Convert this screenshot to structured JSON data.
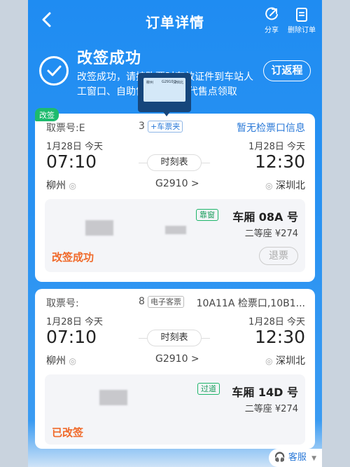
{
  "nav": {
    "title": "订单详情",
    "share_label": "分享",
    "delete_label": "删除订单"
  },
  "status": {
    "title": "改签成功",
    "desc": "改签成功，请持购票时有效证件到车站人工窗口、自助售/取票机或代售点领取",
    "return_btn": "订返程"
  },
  "ticket1": {
    "tag": "改签",
    "pickup_label": "取票号:E",
    "pickup_tail": "3",
    "wallet_badge": "+车票夹",
    "check_info": "暂无检票口信息",
    "depart_date": "1月28日 今天",
    "arrive_date": "1月28日 今天",
    "depart_time": "07:10",
    "arrive_time": "12:30",
    "from": "柳州",
    "to": "深圳北",
    "schedule": "时刻表",
    "train": "G2910 >",
    "seat_tag": "靠窗",
    "seat_num": "车厢 08A 号",
    "seat_class": "二等座 ¥274",
    "seat_status": "改签成功",
    "refund": "退票"
  },
  "ticket2": {
    "pickup_label": "取票号:",
    "pickup_tail": "8",
    "e_ticket_badge": "电子客票",
    "check_info": "10A11A 检票口,10B1...",
    "depart_date": "1月28日 今天",
    "arrive_date": "1月28日 今天",
    "depart_time": "07:10",
    "arrive_time": "12:30",
    "from": "柳州",
    "to": "深圳北",
    "schedule": "时刻表",
    "train": "G2910 >",
    "seat_tag": "过道",
    "seat_num": "车厢 14D 号",
    "seat_class": "二等座 ¥274",
    "seat_status": "已改签"
  },
  "customer_service": "客服",
  "colors": {
    "primary_blue": "#1f8cf2",
    "green": "#1dbb6e",
    "orange": "#f06a2a"
  }
}
